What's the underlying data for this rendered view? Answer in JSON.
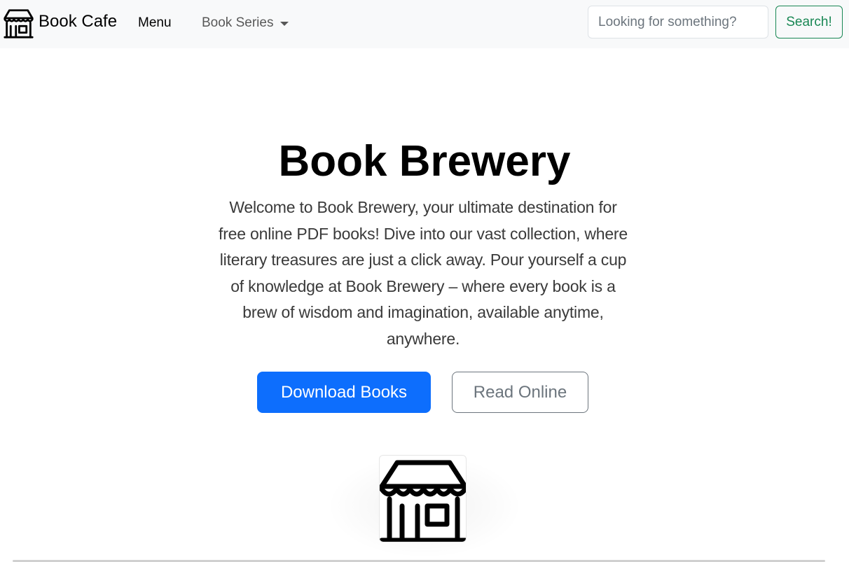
{
  "navbar": {
    "brand_text": "Book Cafe",
    "brand_icon": "storefront-icon",
    "menu_label": "Menu",
    "series_label": "Book Series",
    "search_placeholder": "Looking for something?",
    "search_button_label": "Search!"
  },
  "hero": {
    "title": "Book Brewery",
    "lead": "Welcome to Book Brewery, your ultimate destination for free online PDF books! Dive into our vast collection, where literary treasures are just a click away. Pour yourself a cup of knowledge at Book Brewery – where every book is a brew of wisdom and imagination, available anytime, anywhere.",
    "primary_button_label": "Download Books",
    "secondary_button_label": "Read Online",
    "feature_image_icon": "storefront-icon"
  },
  "colors": {
    "primary": "#0d6efd",
    "success": "#198754",
    "secondary": "#6c757d",
    "navbar_bg": "#f8f9fa"
  }
}
